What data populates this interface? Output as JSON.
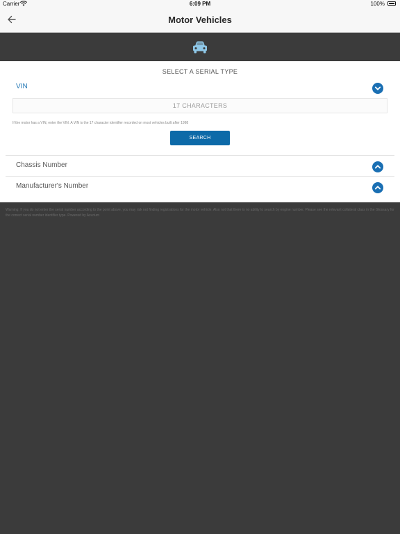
{
  "status_bar": {
    "carrier": "Carrier",
    "time": "6:09 PM",
    "battery": "100%"
  },
  "nav": {
    "title": "Motor Vehicles",
    "back_icon": "arrow-left-icon"
  },
  "hero": {
    "icon": "car-icon",
    "icon_color": "#8fc8e8"
  },
  "form": {
    "section_title": "SELECT A SERIAL TYPE",
    "selected_type": "VIN",
    "vin_placeholder": "17 CHARACTERS",
    "vin_value": "",
    "helper_text": "If the motor has a VIN, enter the VIN. A VIN is the 17 character identifier recorded on most vehicles built after 1998",
    "search_label": "SEARCH",
    "other_types": [
      {
        "label": "Chassis Number"
      },
      {
        "label": "Manufacturer's Number"
      }
    ]
  },
  "footer": {
    "warning": "Warning: If you do not enter the serial number according to the point above, you may risk not finding registrations for the motor vehicle. Also not that there is no ability to search by engine number. Please see the relevant collateral class in the Glossary for the correct serial number identifier type. Powered by Azurium"
  },
  "colors": {
    "accent": "#1a6fb3",
    "button": "#0d6aa8",
    "background_dark": "#3b3b3b"
  }
}
